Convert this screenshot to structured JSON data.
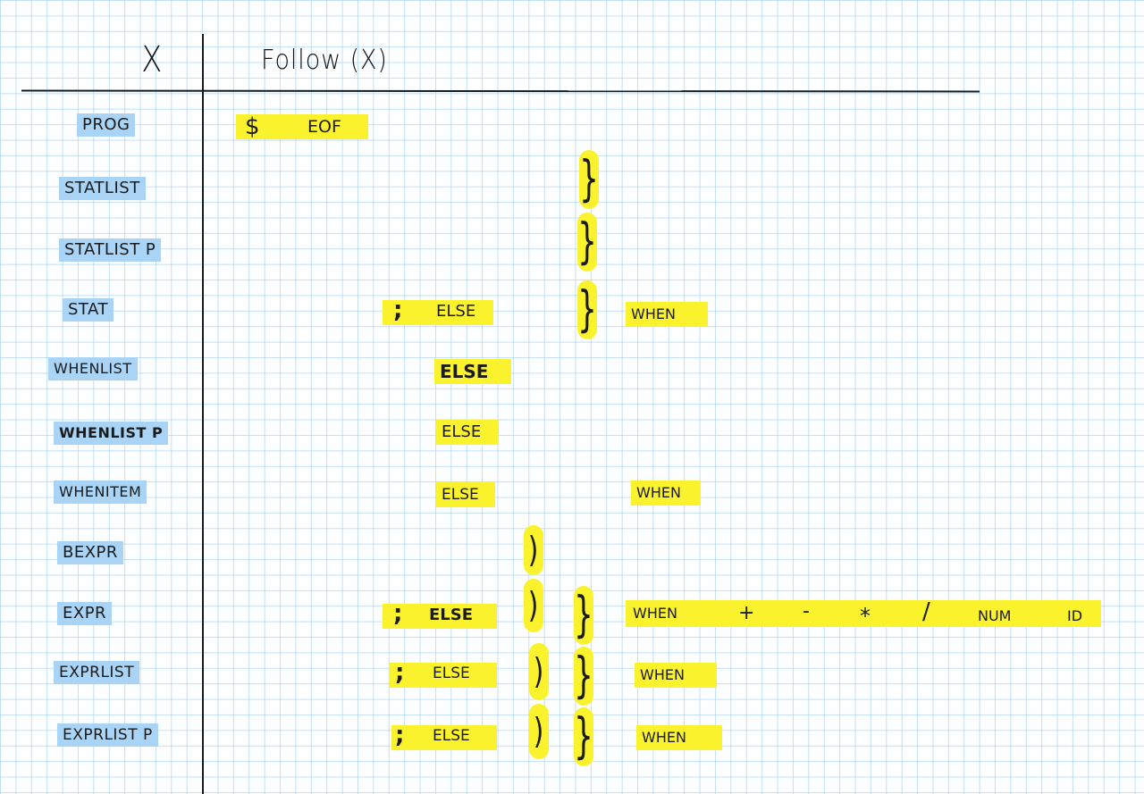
{
  "header": {
    "x": "X",
    "follow": "Follow (X)"
  },
  "rows": {
    "prog": {
      "name": "PROG"
    },
    "statlist": {
      "name": "STATLIST"
    },
    "statlistp": {
      "name": "STATLIST P"
    },
    "stat": {
      "name": "STAT"
    },
    "whenlist": {
      "name": "WHENLIST"
    },
    "whenlistp": {
      "name": "WHENLIST P"
    },
    "whenitem": {
      "name": "WHENITEM"
    },
    "bexpr": {
      "name": "BEXPR"
    },
    "expr": {
      "name": "EXPR"
    },
    "exprlist": {
      "name": "EXPRLIST"
    },
    "exprlistp": {
      "name": "EXPRLIST P"
    }
  },
  "symbols": {
    "dollar": "$",
    "eof": "EOF",
    "semicolon": ";",
    "else": "ELSE",
    "rparen": ")",
    "rbrace": "}",
    "when": "WHEN",
    "plus": "+",
    "minus": "-",
    "times": "*",
    "divide": "/",
    "num": "NUM",
    "id": "ID"
  },
  "colors": {
    "highlight_yellow": "#fbf22e",
    "highlight_blue": "#a9d4f5",
    "grid": "#96c8eb"
  }
}
